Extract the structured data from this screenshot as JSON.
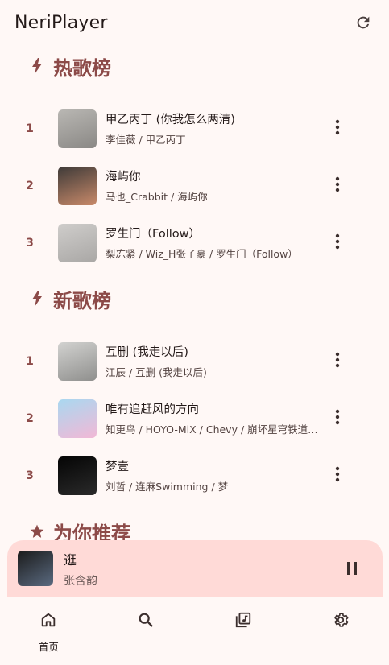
{
  "app": {
    "title": "NeriPlayer"
  },
  "sections": [
    {
      "title": "热歌榜",
      "icon": "bolt-icon",
      "songs": [
        {
          "rank": "1",
          "title": "甲乙丙丁 (你我怎么两清)",
          "subtitle": "李佳薇 / 甲乙丙丁",
          "cover": [
            "#b9b7b3",
            "#8a8885"
          ]
        },
        {
          "rank": "2",
          "title": "海屿你",
          "subtitle": "马也_Crabbit / 海屿你",
          "cover": [
            "#3e3a38",
            "#c98a6a"
          ]
        },
        {
          "rank": "3",
          "title": "罗生门（Follow）",
          "subtitle": "梨冻紧 / Wiz_H张子豪 / 罗生门（Follow）",
          "cover": [
            "#cfcdcb",
            "#a9a7a5"
          ]
        }
      ]
    },
    {
      "title": "新歌榜",
      "icon": "bolt-icon",
      "songs": [
        {
          "rank": "1",
          "title": "互删 (我走以后)",
          "subtitle": "江辰 / 互删 (我走以后)",
          "cover": [
            "#d2d2d0",
            "#8f8f8d"
          ]
        },
        {
          "rank": "2",
          "title": "唯有追赶风的方向",
          "subtitle": "知更鸟 / HOYO-MiX / Chevy / 崩坏星穹铁道-空气蛹",
          "cover": [
            "#a9d8f0",
            "#f2b8d6"
          ]
        },
        {
          "rank": "3",
          "title": "梦壹",
          "subtitle": "刘哲 / 连麻Swimming / 梦",
          "cover": [
            "#050505",
            "#2a2a2a"
          ]
        }
      ]
    },
    {
      "title": "为你推荐",
      "icon": "star-icon",
      "songs": []
    }
  ],
  "now_playing": {
    "title": "逛",
    "artist": "张含韵",
    "cover": [
      "#1b1b1b",
      "#5a6a80"
    ]
  },
  "nav": [
    {
      "label": "首页",
      "icon": "home-icon"
    },
    {
      "label": "",
      "icon": "search-icon"
    },
    {
      "label": "",
      "icon": "library-icon"
    },
    {
      "label": "",
      "icon": "settings-icon"
    }
  ],
  "colors": {
    "background": "#fff8f6",
    "accent": "#8c4a48",
    "mini_player": "#ffdad7"
  }
}
